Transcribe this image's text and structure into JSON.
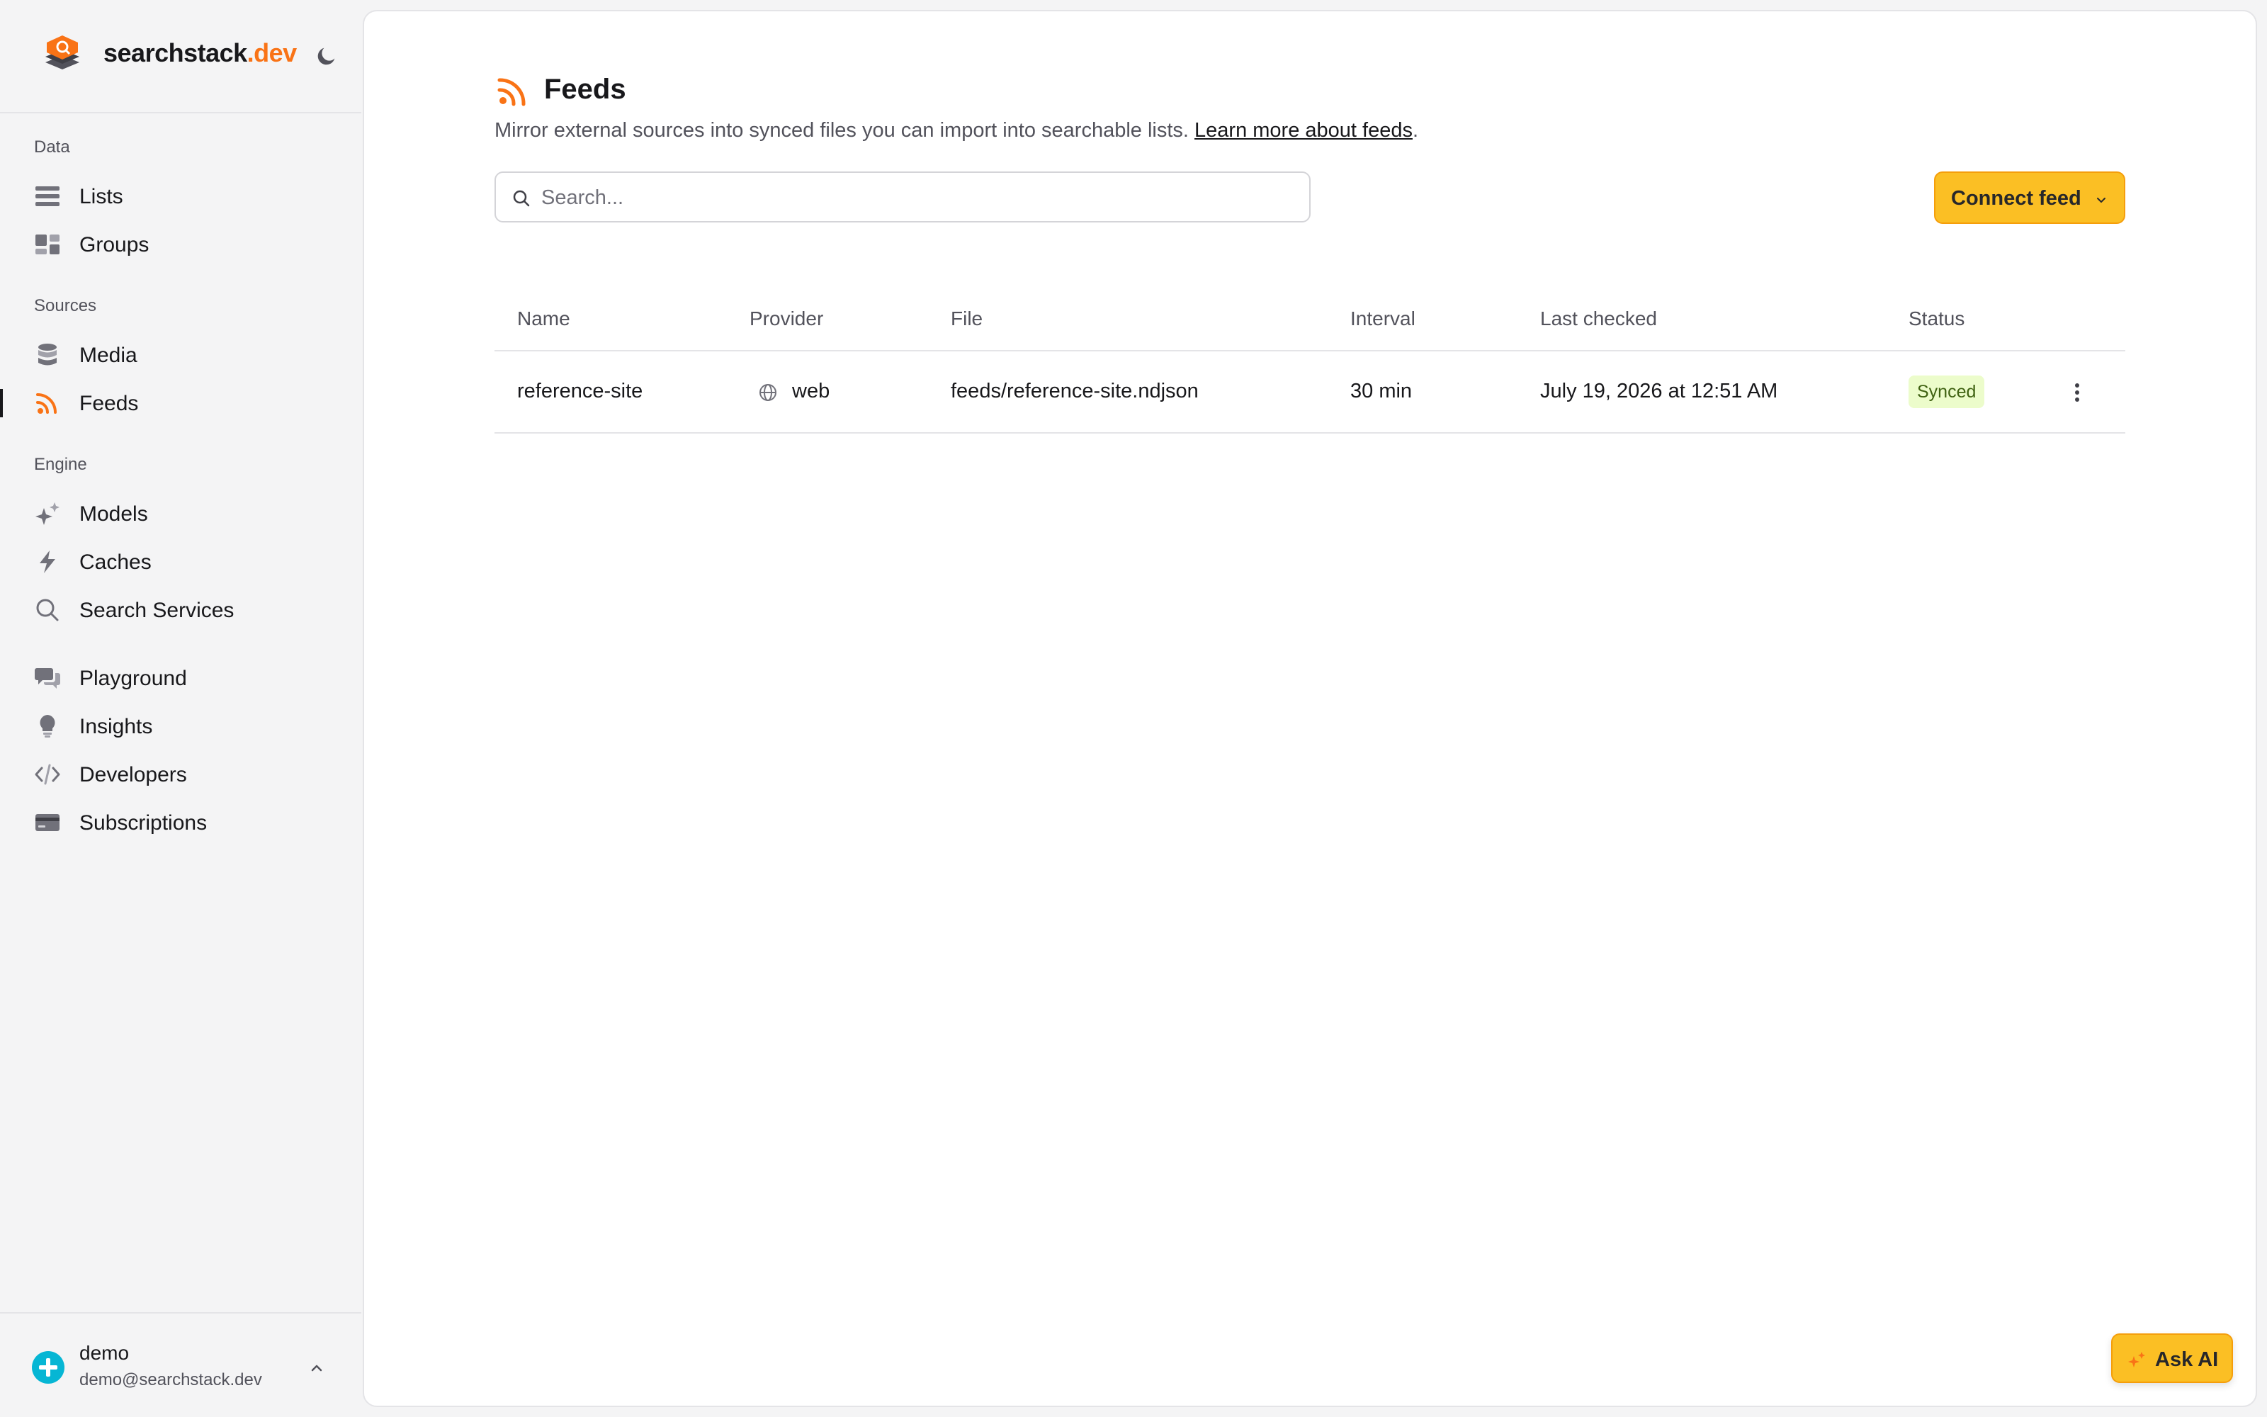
{
  "brand": {
    "name": "searchstack",
    "tld": ".dev"
  },
  "sidebar": {
    "sections": [
      {
        "label": "Data"
      },
      {
        "label": "Sources"
      },
      {
        "label": "Engine"
      }
    ],
    "items": [
      {
        "label": "Lists",
        "icon": "list-icon"
      },
      {
        "label": "Groups",
        "icon": "groups-icon"
      },
      {
        "label": "Media",
        "icon": "database-icon"
      },
      {
        "label": "Feeds",
        "icon": "rss-icon",
        "active": true
      },
      {
        "label": "Models",
        "icon": "sparkles-icon"
      },
      {
        "label": "Caches",
        "icon": "lightning-icon"
      },
      {
        "label": "Search Services",
        "icon": "search-icon"
      },
      {
        "label": "Playground",
        "icon": "chat-icon"
      },
      {
        "label": "Insights",
        "icon": "lightbulb-icon"
      },
      {
        "label": "Developers",
        "icon": "code-icon"
      },
      {
        "label": "Subscriptions",
        "icon": "credit-card-icon"
      }
    ]
  },
  "user": {
    "name": "demo",
    "email": "demo@searchstack.dev"
  },
  "page": {
    "title": "Feeds",
    "description": "Mirror external sources into synced files you can import into searchable lists.",
    "learn_more": "Learn more about feeds",
    "description_end": "."
  },
  "search": {
    "placeholder": "Search...",
    "value": ""
  },
  "toolbar": {
    "connect_label": "Connect feed"
  },
  "table": {
    "columns": [
      "Name",
      "Provider",
      "File",
      "Interval",
      "Last checked",
      "Status"
    ],
    "rows": [
      {
        "name": "reference-site",
        "provider": "web",
        "file": "feeds/reference-site.ndjson",
        "interval": "30 min",
        "last_checked": "July 19, 2026 at 12:51 AM",
        "status": "Synced"
      }
    ]
  },
  "ask_ai": {
    "label": "Ask AI"
  },
  "colors": {
    "accent": "#f97316",
    "button": "#fbbf24",
    "status_synced_bg": "#ecfccb",
    "status_synced_text": "#3f6212"
  }
}
